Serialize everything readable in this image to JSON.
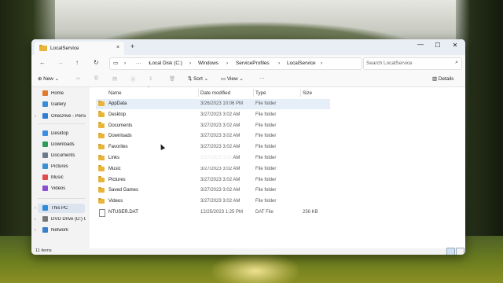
{
  "window": {
    "tab_title": "LocalService",
    "tab_close": "×",
    "new_tab": "+",
    "minimize": "—",
    "maximize": "☐",
    "close": "✕"
  },
  "nav": {
    "back": "←",
    "forward": "→",
    "up": "↑",
    "refresh": "↻",
    "pc_icon": "▭",
    "more": "···",
    "breadcrumb": [
      "Local Disk (C:)",
      "Windows",
      "ServiceProfiles",
      "LocalService"
    ],
    "sep": "›",
    "search_placeholder": "Search LocalService",
    "search_icon": "⌕"
  },
  "commands": {
    "new": "New",
    "sort": "Sort",
    "view": "View",
    "more": "···",
    "details": "Details"
  },
  "sidebar": [
    {
      "label": "Home",
      "icon": "home-icon",
      "color": "#e07a2c",
      "chev": ""
    },
    {
      "label": "Gallery",
      "icon": "gallery-icon",
      "color": "#3a8bd8",
      "chev": ""
    },
    {
      "label": "OneDrive - Perso",
      "icon": "cloud-icon",
      "color": "#2d7fd3",
      "chev": "›"
    },
    {
      "label": "Desktop",
      "icon": "desktop-icon",
      "color": "#3d8de0",
      "chev": ""
    },
    {
      "label": "Downloads",
      "icon": "download-icon",
      "color": "#2f9a5f",
      "chev": ""
    },
    {
      "label": "Documents",
      "icon": "documents-icon",
      "color": "#6c7a8a",
      "chev": ""
    },
    {
      "label": "Pictures",
      "icon": "pictures-icon",
      "color": "#3b8fd6",
      "chev": ""
    },
    {
      "label": "Music",
      "icon": "music-icon",
      "color": "#e04a4a",
      "chev": ""
    },
    {
      "label": "Videos",
      "icon": "videos-icon",
      "color": "#8a4fd0",
      "chev": ""
    },
    {
      "label": "This PC",
      "icon": "pc-icon",
      "color": "#2f8ad8",
      "chev": "›"
    },
    {
      "label": "DVD Drive (D:) C",
      "icon": "dvd-icon",
      "color": "#777777",
      "chev": "›"
    },
    {
      "label": "Network",
      "icon": "network-icon",
      "color": "#3a7fcc",
      "chev": "›"
    }
  ],
  "columns": {
    "name": "Name",
    "date": "Date modified",
    "type": "Type",
    "size": "Size"
  },
  "files": [
    {
      "name": "AppData",
      "date": "3/26/2023 10:06 PM",
      "type": "File folder",
      "size": "",
      "kind": "folder"
    },
    {
      "name": "Desktop",
      "date": "3/27/2023 3:02 AM",
      "type": "File folder",
      "size": "",
      "kind": "folder"
    },
    {
      "name": "Documents",
      "date": "3/27/2023 3:02 AM",
      "type": "File folder",
      "size": "",
      "kind": "folder"
    },
    {
      "name": "Downloads",
      "date": "3/27/2023 3:02 AM",
      "type": "File folder",
      "size": "",
      "kind": "folder"
    },
    {
      "name": "Favorites",
      "date": "3/27/2023 3:02 AM",
      "type": "File folder",
      "size": "",
      "kind": "folder"
    },
    {
      "name": "Links",
      "date": "3/27/2023 3:02 AM",
      "type": "File folder",
      "size": "",
      "kind": "folder"
    },
    {
      "name": "Music",
      "date": "3/27/2023 3:02 AM",
      "type": "File folder",
      "size": "",
      "kind": "folder"
    },
    {
      "name": "Pictures",
      "date": "3/27/2023 3:02 AM",
      "type": "File folder",
      "size": "",
      "kind": "folder"
    },
    {
      "name": "Saved Games",
      "date": "3/27/2023 3:02 AM",
      "type": "File folder",
      "size": "",
      "kind": "folder"
    },
    {
      "name": "Videos",
      "date": "3/27/2023 3:02 AM",
      "type": "File folder",
      "size": "",
      "kind": "folder"
    },
    {
      "name": "NTUSER.DAT",
      "date": "12/25/2023 1:25 PM",
      "type": "DAT File",
      "size": "256 KB",
      "kind": "file"
    }
  ],
  "status": {
    "count": "11 items"
  }
}
